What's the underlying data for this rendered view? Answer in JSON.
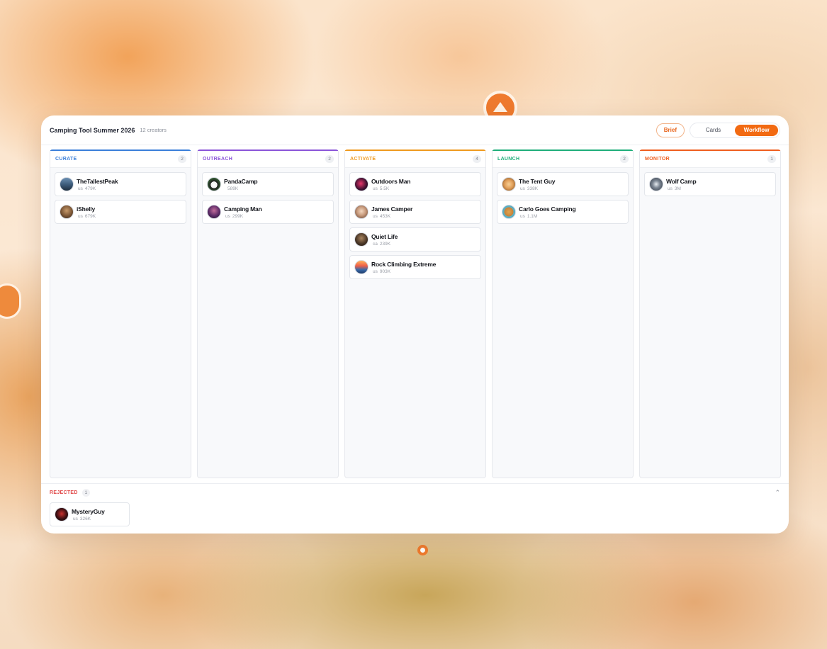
{
  "project": {
    "title": "Camping Tool Summer 2026",
    "subtitle": "12 creators"
  },
  "toolbar": {
    "brief_label": "Brief",
    "view_options": [
      {
        "label": "Cards",
        "active": false
      },
      {
        "label": "Workflow",
        "active": true
      }
    ]
  },
  "colors": {
    "accent": "#f26a12",
    "curate": "#3b7fd9",
    "outreach": "#8a55d8",
    "activate": "#ef9a1f",
    "launch": "#1fae7a",
    "monitor": "#ef5e1f",
    "rejected": "#e04848"
  },
  "columns": [
    {
      "title": "CURATE",
      "count": "2",
      "color": "#3b7fd9",
      "cards": [
        {
          "name": "TheTallestPeak",
          "region": "us",
          "followers": "479K",
          "avatar": "mountain-lake-avatar"
        },
        {
          "name": "iShelly",
          "region": "us",
          "followers": "679K",
          "avatar": "woman-avatar"
        }
      ]
    },
    {
      "title": "OUTREACH",
      "count": "2",
      "color": "#8a55d8",
      "cards": [
        {
          "name": "PandaCamp",
          "region": "",
          "followers": "589K",
          "avatar": "panda-avatar"
        },
        {
          "name": "Camping Man",
          "region": "us",
          "followers": "299K",
          "avatar": "man-portrait-avatar"
        }
      ]
    },
    {
      "title": "ACTIVATE",
      "count": "4",
      "color": "#ef9a1f",
      "cards": [
        {
          "name": "Outdoors Man",
          "region": "us",
          "followers": "5.5K",
          "avatar": "neon-man-avatar"
        },
        {
          "name": "James Camper",
          "region": "us",
          "followers": "453K",
          "avatar": "cartoon-man-avatar"
        },
        {
          "name": "Quiet Life",
          "region": "ca",
          "followers": "239K",
          "avatar": "woman-dark-avatar"
        },
        {
          "name": "Rock Climbing Extreme",
          "region": "us",
          "followers": "903K",
          "avatar": "sunset-mountain-avatar"
        }
      ]
    },
    {
      "title": "LAUNCH",
      "count": "2",
      "color": "#1fae7a",
      "cards": [
        {
          "name": "The Tent Guy",
          "region": "us",
          "followers": "338K",
          "avatar": "cartoon-boy-avatar"
        },
        {
          "name": "Carlo Goes Camping",
          "region": "us",
          "followers": "1.1M",
          "avatar": "dog-avatar"
        }
      ]
    },
    {
      "title": "MONITOR",
      "count": "1",
      "color": "#ef5e1f",
      "cards": [
        {
          "name": "Wolf Camp",
          "region": "us",
          "followers": "3M",
          "avatar": "wolf-avatar"
        }
      ]
    }
  ],
  "rejected": {
    "title": "REJECTED",
    "count": "1",
    "cards": [
      {
        "name": "MysteryGuy",
        "region": "us",
        "followers": "326K",
        "avatar": "hooded-figure-avatar"
      }
    ]
  }
}
